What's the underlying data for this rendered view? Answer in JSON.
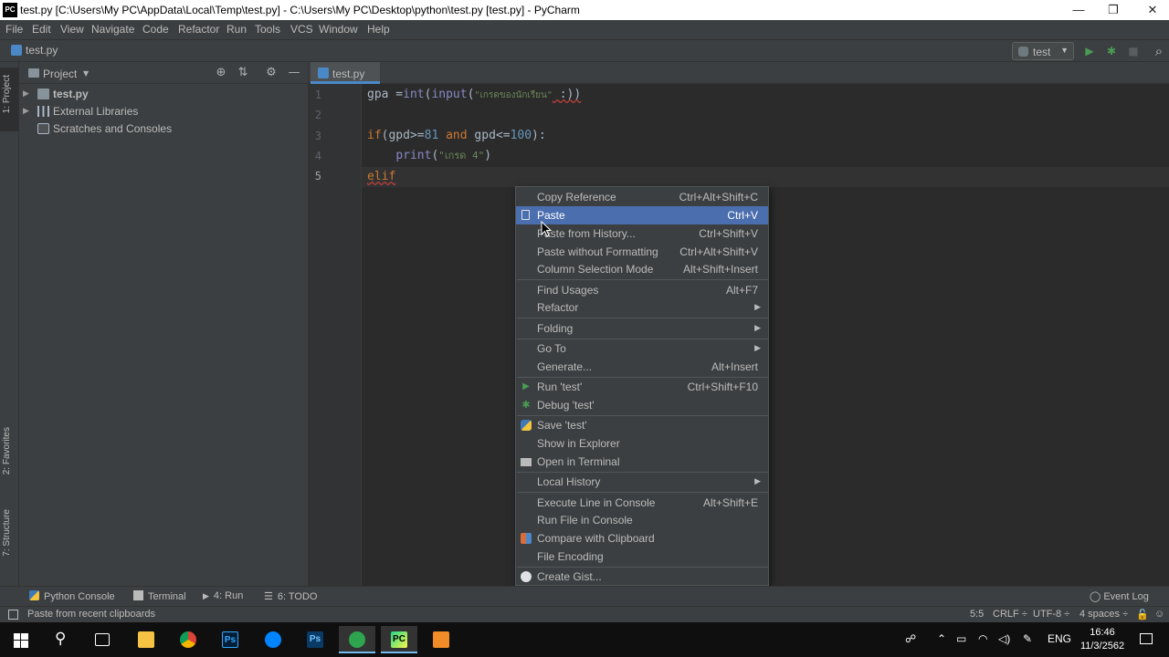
{
  "titlebar": {
    "app_logo": "PC",
    "title": "test.py [C:\\Users\\My PC\\AppData\\Local\\Temp\\test.py] - C:\\Users\\My PC\\Desktop\\python\\test.py [test.py] - PyCharm",
    "minimize": "—",
    "maximize": "❐",
    "close": "✕"
  },
  "menubar": {
    "items": [
      "File",
      "Edit",
      "View",
      "Navigate",
      "Code",
      "Refactor",
      "Run",
      "Tools",
      "VCS",
      "Window",
      "Help"
    ]
  },
  "navbar": {
    "breadcrumb": "test.py",
    "run_config": "test",
    "run_icon": "▶",
    "debug_icon": "✱",
    "stop_icon": "■",
    "search_icon": "⌕"
  },
  "left_strip": {
    "project_tab": "1: Project",
    "favorites_tab": "2: Favorites",
    "structure_tab": "7: Structure"
  },
  "project_panel": {
    "title": "Project",
    "dropdown": "▼",
    "locate_icon": "⊕",
    "collapse_icon": "⇅",
    "settings_icon": "⚙",
    "hide_icon": "—",
    "tree": [
      {
        "label": "test.py",
        "icon": "folder-icon",
        "bold": true
      },
      {
        "label": "External Libraries",
        "icon": "library-icon"
      },
      {
        "label": "Scratches and Consoles",
        "icon": "scratches-icon"
      }
    ]
  },
  "editor": {
    "tab_label": "test.py",
    "line_numbers": [
      "1",
      "2",
      "3",
      "4",
      "5"
    ],
    "lines": {
      "l1": {
        "a": "gpa =",
        "b": "int",
        "c": "(",
        "d": "input",
        "e": "(",
        "f": "\"เกรดของนักเรียน\"",
        "g": " :))"
      },
      "l3": {
        "a": "if",
        "b": "(gpd>=",
        "c": "81",
        "d": " ",
        "e": "and",
        "f": " gpd<=",
        "g": "100",
        "h": "):"
      },
      "l4": {
        "a": "    ",
        "b": "print",
        "c": "(",
        "d": "\"เกรด 4\"",
        "e": ")"
      },
      "l5": {
        "a": "elif"
      }
    }
  },
  "context_menu": {
    "items": [
      {
        "label": "Copy Reference",
        "shortcut": "Ctrl+Alt+Shift+C"
      },
      {
        "label": "Paste",
        "shortcut": "Ctrl+V",
        "icon": "paste-icon",
        "selected": true
      },
      {
        "label": "Paste from History...",
        "shortcut": "Ctrl+Shift+V"
      },
      {
        "label": "Paste without Formatting",
        "shortcut": "Ctrl+Alt+Shift+V"
      },
      {
        "label": "Column Selection Mode",
        "shortcut": "Alt+Shift+Insert"
      },
      {
        "label": "Find Usages",
        "shortcut": "Alt+F7"
      },
      {
        "label": "Refactor",
        "submenu": true
      },
      {
        "label": "Folding",
        "submenu": true
      },
      {
        "label": "Go To",
        "submenu": true
      },
      {
        "label": "Generate...",
        "shortcut": "Alt+Insert"
      },
      {
        "label": "Run 'test'",
        "shortcut": "Ctrl+Shift+F10",
        "icon": "run-icon"
      },
      {
        "label": "Debug 'test'",
        "icon": "debug-icon"
      },
      {
        "label": "Save 'test'",
        "icon": "python-icon"
      },
      {
        "label": "Show in Explorer"
      },
      {
        "label": "Open in Terminal",
        "icon": "terminal-icon"
      },
      {
        "label": "Local History",
        "submenu": true
      },
      {
        "label": "Execute Line in Console",
        "shortcut": "Alt+Shift+E"
      },
      {
        "label": "Run File in Console"
      },
      {
        "label": "Compare with Clipboard",
        "icon": "compare-icon"
      },
      {
        "label": "File Encoding"
      },
      {
        "label": "Create Gist...",
        "icon": "github-icon"
      }
    ],
    "submenu_arrow": "▶"
  },
  "bottom_tools": {
    "python_console": "Python Console",
    "terminal": "Terminal",
    "run": "4: Run",
    "todo": "6: TODO",
    "event_log": "Event Log"
  },
  "statusbar": {
    "message": "Paste from recent clipboards",
    "position": "5:5",
    "line_sep": "CRLF ÷",
    "encoding": "UTF-8 ÷",
    "indent": "4 spaces ÷"
  },
  "taskbar": {
    "lang": "ENG",
    "time": "16:46",
    "date": "11/3/2562"
  },
  "colors": {
    "accent": "#4b6eaf",
    "keyword": "#cc7832",
    "number": "#6897bb",
    "string": "#6a8759"
  }
}
